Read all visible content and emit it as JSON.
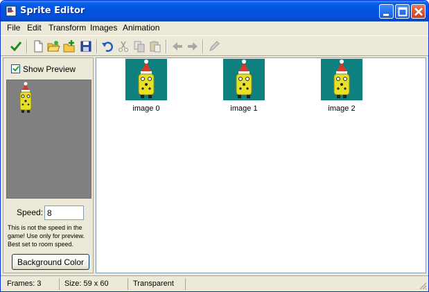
{
  "window": {
    "title": "Sprite Editor"
  },
  "menu": [
    "File",
    "Edit",
    "Transform",
    "Images",
    "Animation"
  ],
  "toolbar": {
    "buttons": [
      "confirm-check-icon",
      "new-file-icon",
      "open-folder-icon",
      "add-from-file-icon",
      "save-icon",
      "undo-icon",
      "cut-icon",
      "copy-icon",
      "paste-icon",
      "arrow-left-icon",
      "arrow-right-icon",
      "pencil-icon"
    ]
  },
  "preview": {
    "show_label": "Show Preview",
    "checked": true
  },
  "speed": {
    "label": "Speed:",
    "value": "8",
    "note": "This is not the speed in the game! Use only for preview. Best set to room speed."
  },
  "background_button": "Background Color",
  "images": [
    {
      "label": "image 0"
    },
    {
      "label": "image 1"
    },
    {
      "label": "image 2"
    }
  ],
  "status": {
    "frames": "Frames: 3",
    "size": "Size: 59 x 60",
    "transparency": "Transparent"
  },
  "colors": {
    "thumb_bg": "#0f8080",
    "preview_bg": "#808080",
    "title_bar": "#0054e3"
  }
}
